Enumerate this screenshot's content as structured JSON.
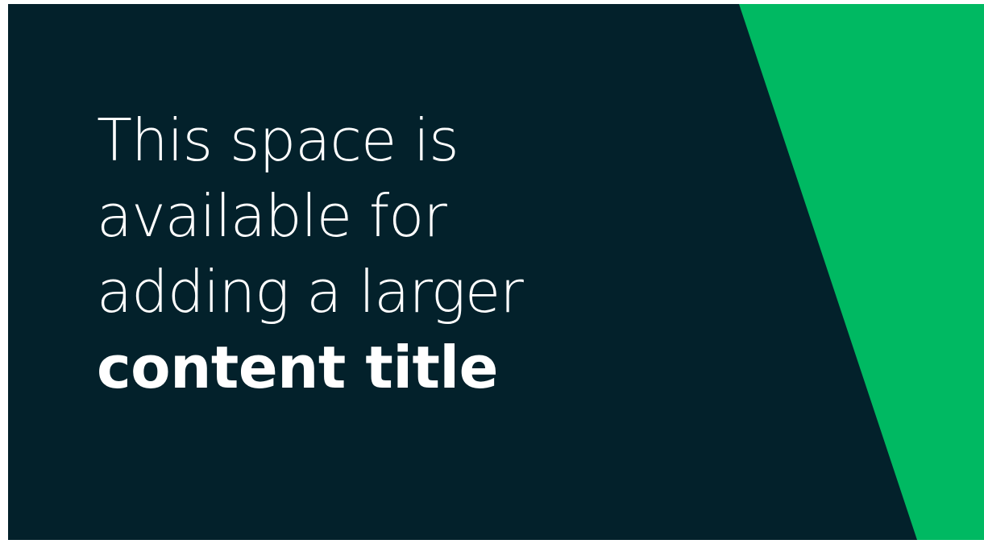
{
  "slide": {
    "colors": {
      "background": "#03212b",
      "accent": "#00b962",
      "text": "#ffffff"
    },
    "title": {
      "line1": "This space is",
      "line2": "available for",
      "line3": "adding a larger",
      "line4_bold": "content title"
    }
  }
}
